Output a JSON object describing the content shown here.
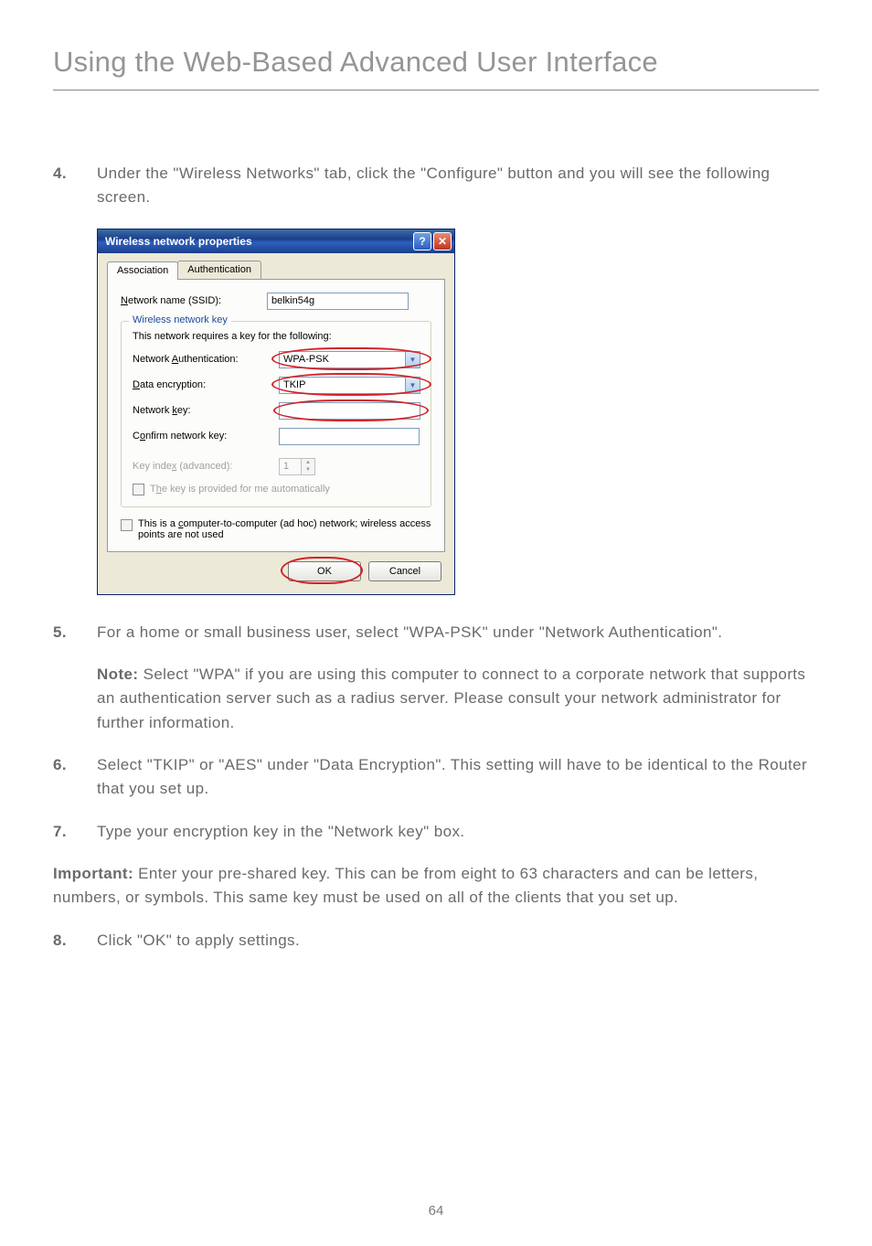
{
  "pageTitle": "Using the Web-Based Advanced User Interface",
  "pageNumber": "64",
  "steps": {
    "s4": {
      "num": "4.",
      "text": "Under the \"Wireless Networks\" tab, click the \"Configure\" button and you will see the following screen."
    },
    "s5": {
      "num": "5.",
      "text": "For a home or small business user, select \"WPA-PSK\" under \"Network Authentication\".",
      "noteLabel": "Note:",
      "noteText": " Select \"WPA\" if you are using this computer to connect to a corporate network that supports an authentication server such as a radius server. Please consult your network administrator for further information."
    },
    "s6": {
      "num": "6.",
      "text": "Select \"TKIP\" or \"AES\" under \"Data Encryption\". This setting will have to be identical to the Router that you set up."
    },
    "s7": {
      "num": "7.",
      "text": "Type your encryption key in the \"Network key\" box."
    },
    "important": {
      "label": "Important:",
      "text": " Enter your pre-shared key. This can be from eight to 63 characters and can be letters, numbers, or symbols. This same key must be used on all of the clients that you set up."
    },
    "s8": {
      "num": "8.",
      "text": "Click \"OK\" to apply settings."
    }
  },
  "dialog": {
    "title": "Wireless network properties",
    "helpGlyph": "?",
    "closeGlyph": "✕",
    "tabs": {
      "association": "Association",
      "authentication": "Authentication"
    },
    "ssidLabel": "Network name (SSID):",
    "ssidValue": "belkin54g",
    "wnkLegend": "Wireless network key",
    "requiresText": "This network requires a key for the following:",
    "authLabel": "Network Authentication:",
    "authValue": "WPA-PSK",
    "encLabel": "Data encryption:",
    "encValue": "TKIP",
    "netKeyLabel": "Network key:",
    "confirmKeyLabel": "Confirm network key:",
    "keyIndexLabel": "Key index (advanced):",
    "keyIndexValue": "1",
    "autoKeyLabel": "The key is provided for me automatically",
    "adhocLabel": "This is a computer-to-computer (ad hoc) network; wireless access points are not used",
    "okLabel": "OK",
    "cancelLabel": "Cancel",
    "dropdownGlyph": "▼",
    "spinUp": "▲",
    "spinDown": "▼"
  }
}
